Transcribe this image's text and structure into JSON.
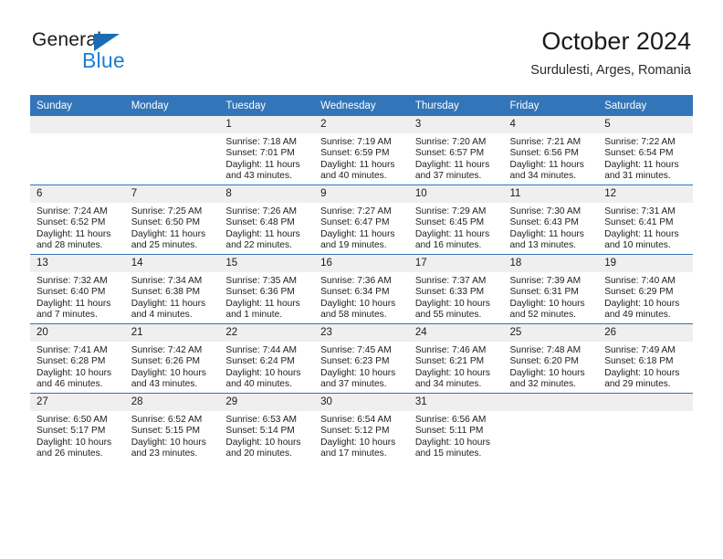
{
  "brand": {
    "name_top": "General",
    "name_bottom": "Blue",
    "triangle_color": "#1b6cb3",
    "blue_color": "#1b7fd4"
  },
  "header": {
    "title": "October 2024",
    "subtitle": "Surdulesti, Arges, Romania"
  },
  "theme": {
    "header_bg": "#3275b8",
    "daynum_bg": "#efefef",
    "grid_line": "#3275b8"
  },
  "weekday_headers": [
    "Sunday",
    "Monday",
    "Tuesday",
    "Wednesday",
    "Thursday",
    "Friday",
    "Saturday"
  ],
  "labels": {
    "sunrise_prefix": "Sunrise:",
    "sunset_prefix": "Sunset:",
    "daylight_prefix": "Daylight:"
  },
  "weeks": [
    [
      {
        "day": "",
        "sunrise": "",
        "sunset": "",
        "daylight": ""
      },
      {
        "day": "",
        "sunrise": "",
        "sunset": "",
        "daylight": ""
      },
      {
        "day": "1",
        "sunrise": "Sunrise: 7:18 AM",
        "sunset": "Sunset: 7:01 PM",
        "daylight": "Daylight: 11 hours and 43 minutes."
      },
      {
        "day": "2",
        "sunrise": "Sunrise: 7:19 AM",
        "sunset": "Sunset: 6:59 PM",
        "daylight": "Daylight: 11 hours and 40 minutes."
      },
      {
        "day": "3",
        "sunrise": "Sunrise: 7:20 AM",
        "sunset": "Sunset: 6:57 PM",
        "daylight": "Daylight: 11 hours and 37 minutes."
      },
      {
        "day": "4",
        "sunrise": "Sunrise: 7:21 AM",
        "sunset": "Sunset: 6:56 PM",
        "daylight": "Daylight: 11 hours and 34 minutes."
      },
      {
        "day": "5",
        "sunrise": "Sunrise: 7:22 AM",
        "sunset": "Sunset: 6:54 PM",
        "daylight": "Daylight: 11 hours and 31 minutes."
      }
    ],
    [
      {
        "day": "6",
        "sunrise": "Sunrise: 7:24 AM",
        "sunset": "Sunset: 6:52 PM",
        "daylight": "Daylight: 11 hours and 28 minutes."
      },
      {
        "day": "7",
        "sunrise": "Sunrise: 7:25 AM",
        "sunset": "Sunset: 6:50 PM",
        "daylight": "Daylight: 11 hours and 25 minutes."
      },
      {
        "day": "8",
        "sunrise": "Sunrise: 7:26 AM",
        "sunset": "Sunset: 6:48 PM",
        "daylight": "Daylight: 11 hours and 22 minutes."
      },
      {
        "day": "9",
        "sunrise": "Sunrise: 7:27 AM",
        "sunset": "Sunset: 6:47 PM",
        "daylight": "Daylight: 11 hours and 19 minutes."
      },
      {
        "day": "10",
        "sunrise": "Sunrise: 7:29 AM",
        "sunset": "Sunset: 6:45 PM",
        "daylight": "Daylight: 11 hours and 16 minutes."
      },
      {
        "day": "11",
        "sunrise": "Sunrise: 7:30 AM",
        "sunset": "Sunset: 6:43 PM",
        "daylight": "Daylight: 11 hours and 13 minutes."
      },
      {
        "day": "12",
        "sunrise": "Sunrise: 7:31 AM",
        "sunset": "Sunset: 6:41 PM",
        "daylight": "Daylight: 11 hours and 10 minutes."
      }
    ],
    [
      {
        "day": "13",
        "sunrise": "Sunrise: 7:32 AM",
        "sunset": "Sunset: 6:40 PM",
        "daylight": "Daylight: 11 hours and 7 minutes."
      },
      {
        "day": "14",
        "sunrise": "Sunrise: 7:34 AM",
        "sunset": "Sunset: 6:38 PM",
        "daylight": "Daylight: 11 hours and 4 minutes."
      },
      {
        "day": "15",
        "sunrise": "Sunrise: 7:35 AM",
        "sunset": "Sunset: 6:36 PM",
        "daylight": "Daylight: 11 hours and 1 minute."
      },
      {
        "day": "16",
        "sunrise": "Sunrise: 7:36 AM",
        "sunset": "Sunset: 6:34 PM",
        "daylight": "Daylight: 10 hours and 58 minutes."
      },
      {
        "day": "17",
        "sunrise": "Sunrise: 7:37 AM",
        "sunset": "Sunset: 6:33 PM",
        "daylight": "Daylight: 10 hours and 55 minutes."
      },
      {
        "day": "18",
        "sunrise": "Sunrise: 7:39 AM",
        "sunset": "Sunset: 6:31 PM",
        "daylight": "Daylight: 10 hours and 52 minutes."
      },
      {
        "day": "19",
        "sunrise": "Sunrise: 7:40 AM",
        "sunset": "Sunset: 6:29 PM",
        "daylight": "Daylight: 10 hours and 49 minutes."
      }
    ],
    [
      {
        "day": "20",
        "sunrise": "Sunrise: 7:41 AM",
        "sunset": "Sunset: 6:28 PM",
        "daylight": "Daylight: 10 hours and 46 minutes."
      },
      {
        "day": "21",
        "sunrise": "Sunrise: 7:42 AM",
        "sunset": "Sunset: 6:26 PM",
        "daylight": "Daylight: 10 hours and 43 minutes."
      },
      {
        "day": "22",
        "sunrise": "Sunrise: 7:44 AM",
        "sunset": "Sunset: 6:24 PM",
        "daylight": "Daylight: 10 hours and 40 minutes."
      },
      {
        "day": "23",
        "sunrise": "Sunrise: 7:45 AM",
        "sunset": "Sunset: 6:23 PM",
        "daylight": "Daylight: 10 hours and 37 minutes."
      },
      {
        "day": "24",
        "sunrise": "Sunrise: 7:46 AM",
        "sunset": "Sunset: 6:21 PM",
        "daylight": "Daylight: 10 hours and 34 minutes."
      },
      {
        "day": "25",
        "sunrise": "Sunrise: 7:48 AM",
        "sunset": "Sunset: 6:20 PM",
        "daylight": "Daylight: 10 hours and 32 minutes."
      },
      {
        "day": "26",
        "sunrise": "Sunrise: 7:49 AM",
        "sunset": "Sunset: 6:18 PM",
        "daylight": "Daylight: 10 hours and 29 minutes."
      }
    ],
    [
      {
        "day": "27",
        "sunrise": "Sunrise: 6:50 AM",
        "sunset": "Sunset: 5:17 PM",
        "daylight": "Daylight: 10 hours and 26 minutes."
      },
      {
        "day": "28",
        "sunrise": "Sunrise: 6:52 AM",
        "sunset": "Sunset: 5:15 PM",
        "daylight": "Daylight: 10 hours and 23 minutes."
      },
      {
        "day": "29",
        "sunrise": "Sunrise: 6:53 AM",
        "sunset": "Sunset: 5:14 PM",
        "daylight": "Daylight: 10 hours and 20 minutes."
      },
      {
        "day": "30",
        "sunrise": "Sunrise: 6:54 AM",
        "sunset": "Sunset: 5:12 PM",
        "daylight": "Daylight: 10 hours and 17 minutes."
      },
      {
        "day": "31",
        "sunrise": "Sunrise: 6:56 AM",
        "sunset": "Sunset: 5:11 PM",
        "daylight": "Daylight: 10 hours and 15 minutes."
      },
      {
        "day": "",
        "sunrise": "",
        "sunset": "",
        "daylight": ""
      },
      {
        "day": "",
        "sunrise": "",
        "sunset": "",
        "daylight": ""
      }
    ]
  ]
}
